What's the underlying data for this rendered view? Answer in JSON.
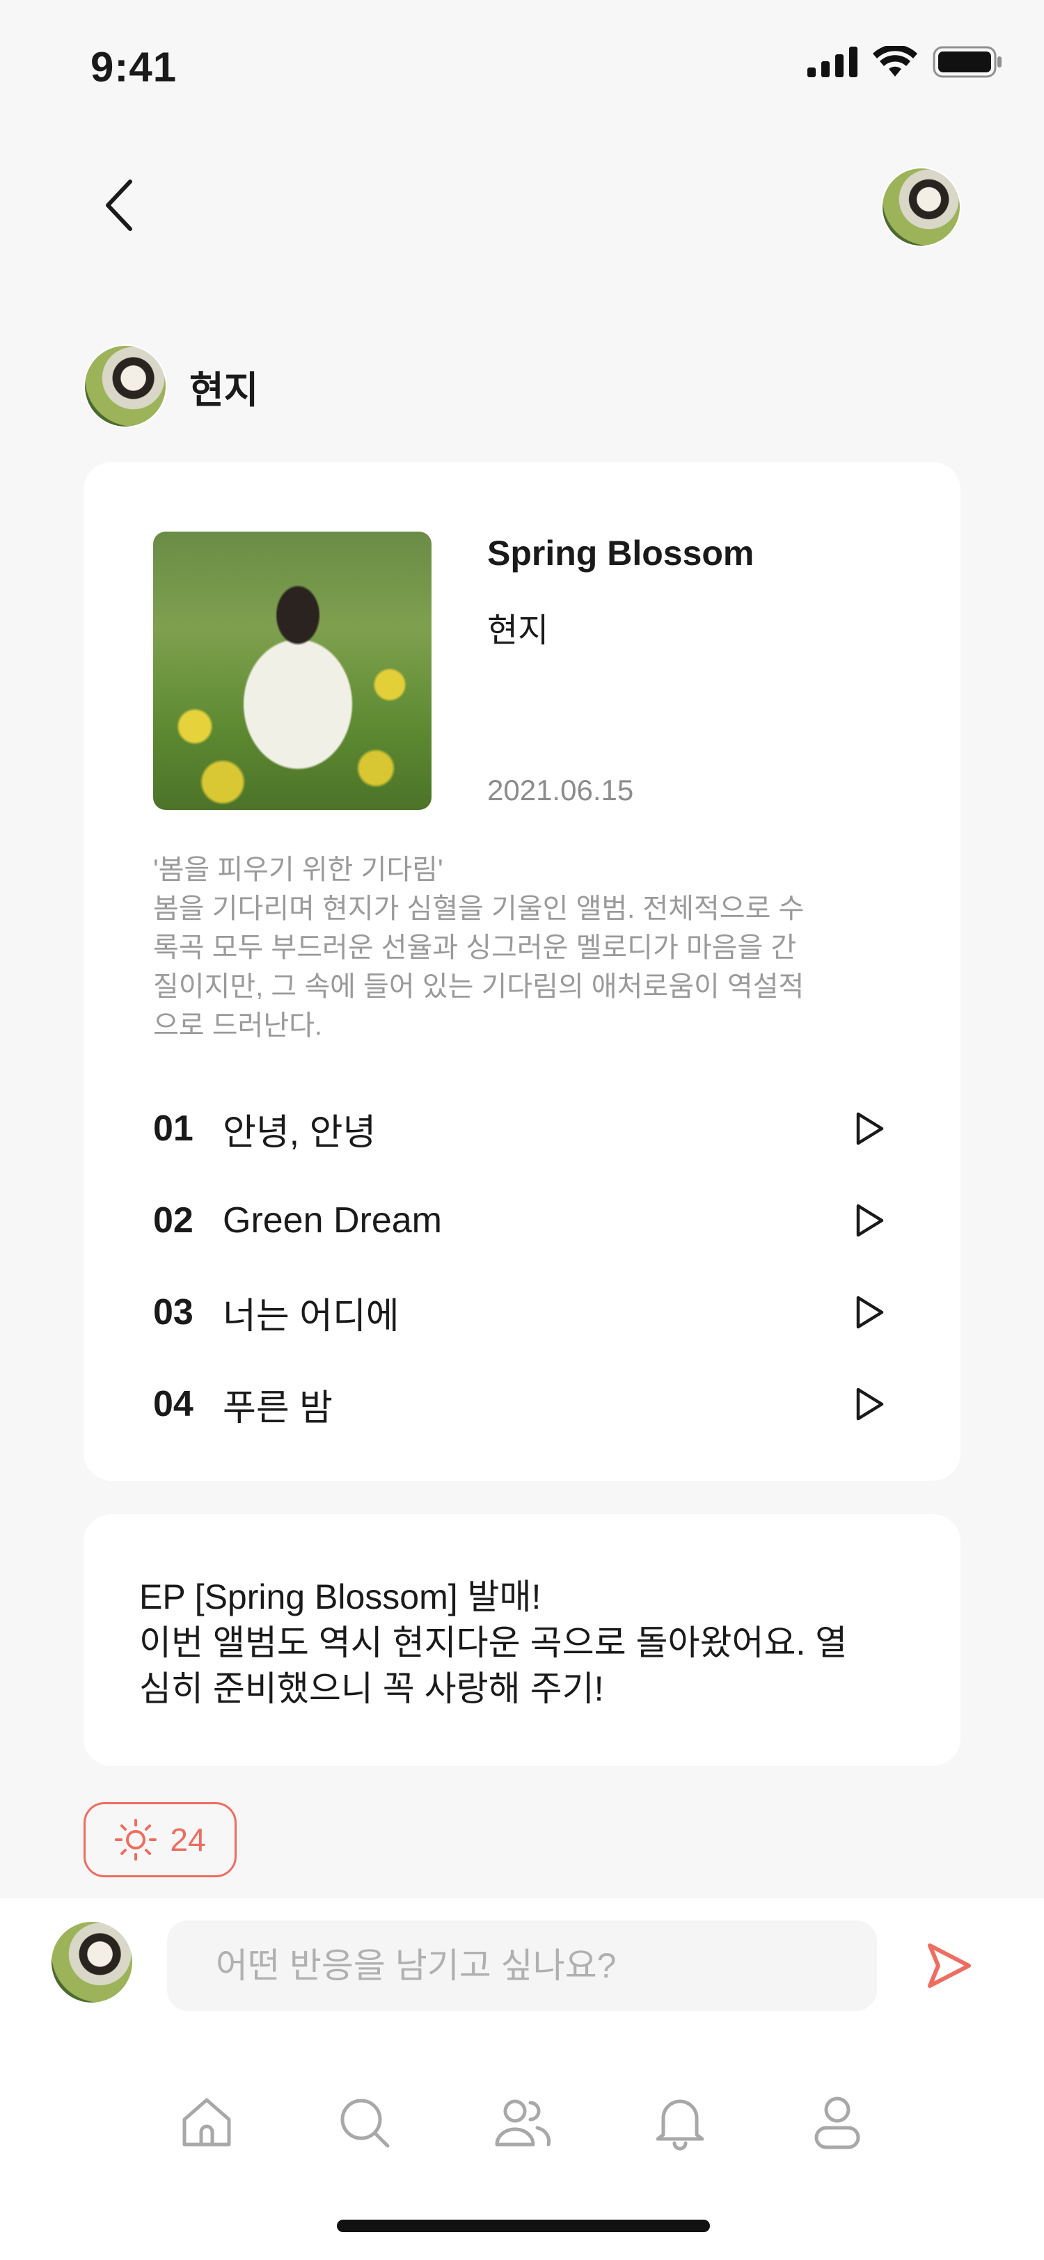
{
  "status_bar": {
    "time": "9:41"
  },
  "header": {
    "back_icon": "chevron-left-icon",
    "profile_icon": "avatar"
  },
  "author": {
    "name": "현지"
  },
  "album": {
    "title": "Spring Blossom",
    "artist": "현지",
    "release_date": "2021.06.15",
    "description_lines": [
      "'봄을 피우기 위한 기다림'",
      "봄을 기다리며 현지가 심혈을 기울인 앨범. 전체적으로 수",
      "록곡 모두 부드러운 선율과 싱그러운 멜로디가 마음을 간",
      "질이지만, 그 속에 들어 있는 기다림의 애처로움이 역설적",
      "으로 드러난다."
    ],
    "tracks": [
      {
        "no": "01",
        "title": "안녕, 안녕"
      },
      {
        "no": "02",
        "title": "Green Dream"
      },
      {
        "no": "03",
        "title": "너는 어디에"
      },
      {
        "no": "04",
        "title": "푸른 밤"
      }
    ]
  },
  "post": {
    "lines": [
      "EP [Spring Blossom] 발매!",
      "이번 앨범도 역시 현지다운 곡으로 돌아왔어요. 열",
      "심히 준비했으니 꼭 사랑해 주기!"
    ]
  },
  "reaction": {
    "icon": "sun-icon",
    "count": "24"
  },
  "comment": {
    "placeholder": "어떤 반응을 남기고 싶나요?",
    "send_icon": "send-icon"
  },
  "nav": [
    "home-icon",
    "search-icon",
    "friends-icon",
    "bell-icon",
    "profile-icon"
  ],
  "colors": {
    "accent": "#ef6d60",
    "background": "#f7f7f7",
    "card": "#ffffff",
    "muted_text": "#9a9a9a"
  }
}
